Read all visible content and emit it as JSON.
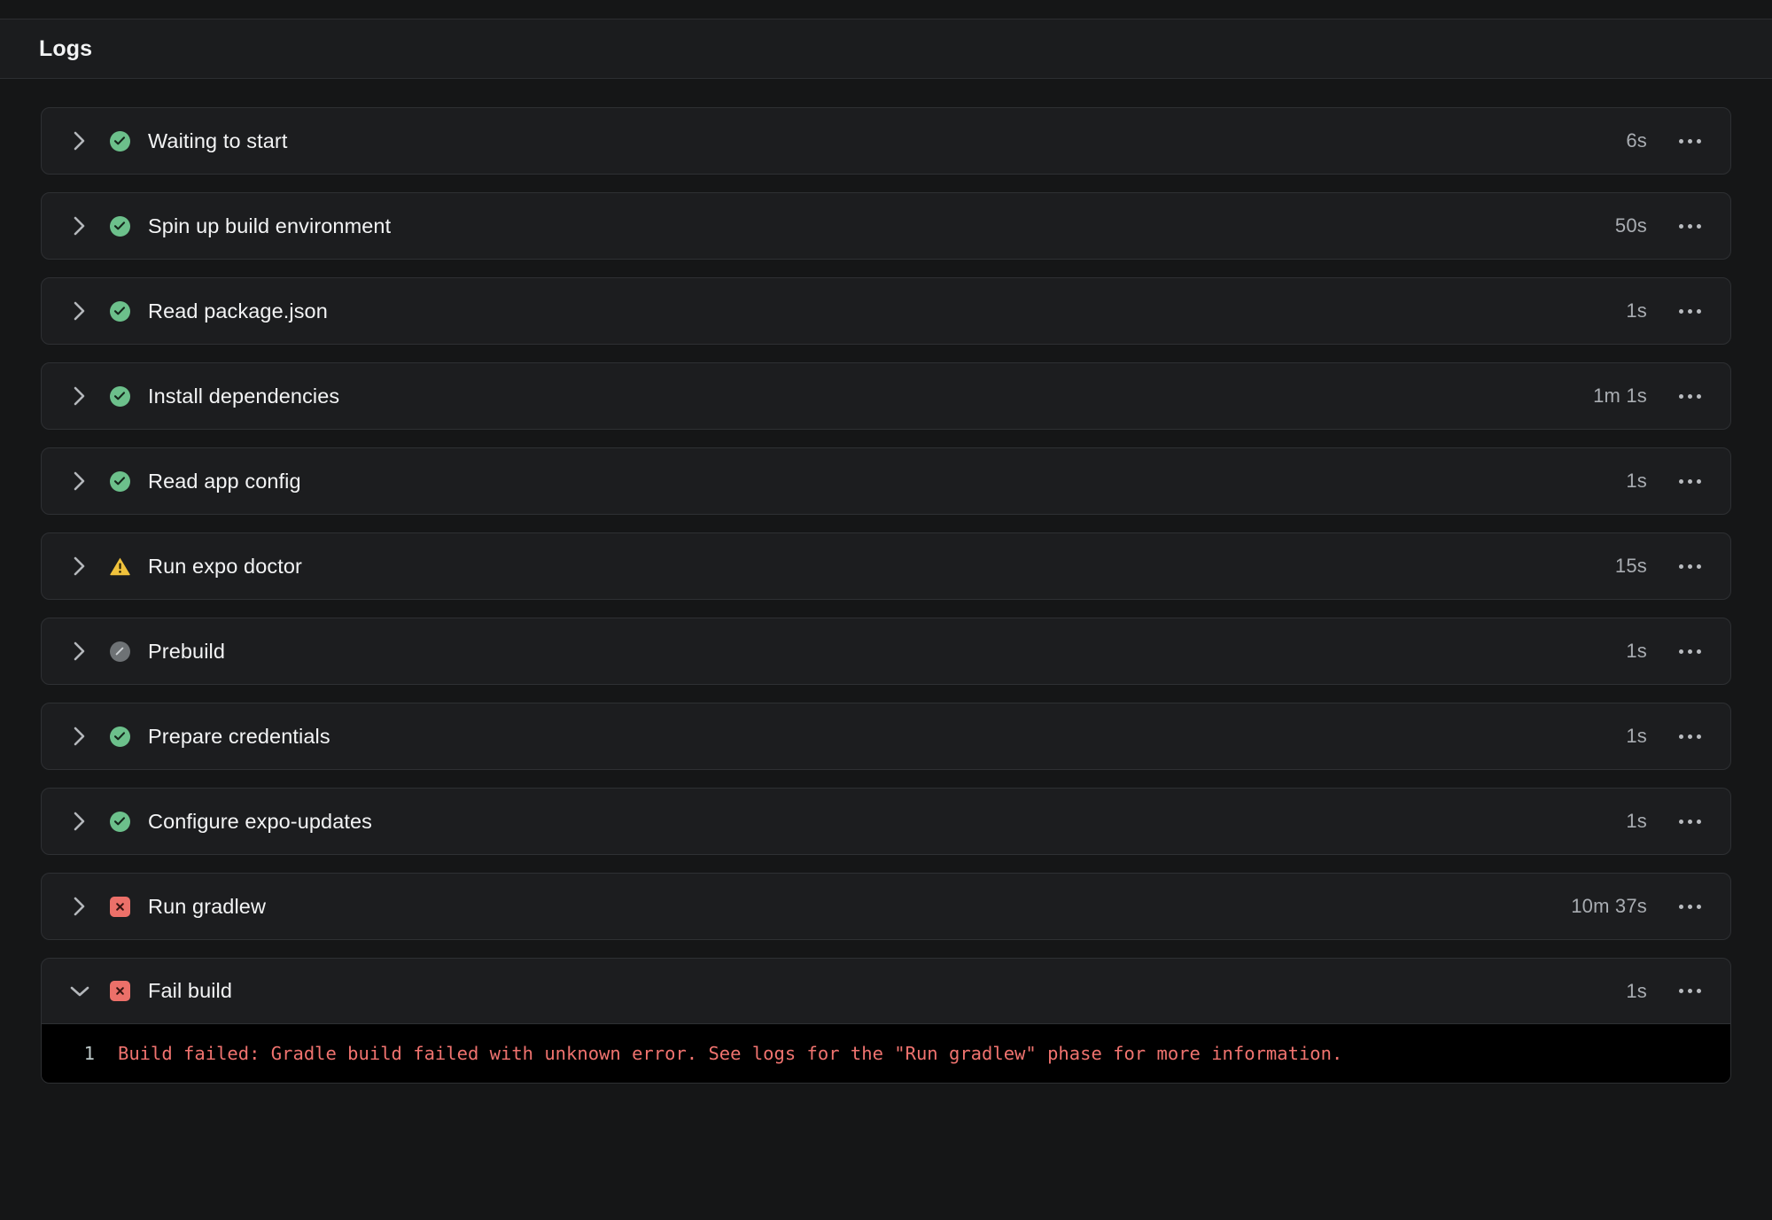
{
  "header": {
    "title": "Logs"
  },
  "icons": {
    "chevron_right": "chevron-right-icon",
    "chevron_down": "chevron-down-icon",
    "success": "check-circle-icon",
    "warning": "warning-triangle-icon",
    "skipped": "skipped-circle-icon",
    "error": "error-square-icon",
    "more": "more-options-icon"
  },
  "colors": {
    "page_bg": "#151617",
    "row_bg": "#1c1d1f",
    "row_border": "#2e3033",
    "header_bg": "#1b1c1e",
    "success": "#6cc08b",
    "warning": "#f0c23c",
    "skipped": "#6e7275",
    "error": "#ec7069",
    "log_bg": "#000000",
    "log_text": "#f0736f",
    "log_gutter": "#bcc8c8",
    "label": "#f3f4f5",
    "duration": "#a9adb2"
  },
  "phases": [
    {
      "label": "Waiting to start",
      "duration": "6s",
      "status": "success",
      "expanded": false
    },
    {
      "label": "Spin up build environment",
      "duration": "50s",
      "status": "success",
      "expanded": false
    },
    {
      "label": "Read package.json",
      "duration": "1s",
      "status": "success",
      "expanded": false
    },
    {
      "label": "Install dependencies",
      "duration": "1m 1s",
      "status": "success",
      "expanded": false
    },
    {
      "label": "Read app config",
      "duration": "1s",
      "status": "success",
      "expanded": false
    },
    {
      "label": "Run expo doctor",
      "duration": "15s",
      "status": "warning",
      "expanded": false
    },
    {
      "label": "Prebuild",
      "duration": "1s",
      "status": "skipped",
      "expanded": false
    },
    {
      "label": "Prepare credentials",
      "duration": "1s",
      "status": "success",
      "expanded": false
    },
    {
      "label": "Configure expo-updates",
      "duration": "1s",
      "status": "success",
      "expanded": false
    },
    {
      "label": "Run gradlew",
      "duration": "10m 37s",
      "status": "error",
      "expanded": false
    },
    {
      "label": "Fail build",
      "duration": "1s",
      "status": "error",
      "expanded": true,
      "log_lines": [
        {
          "number": "1",
          "text": "Build failed: Gradle build failed with unknown error. See logs for the \"Run gradlew\" phase for more information."
        }
      ]
    }
  ]
}
